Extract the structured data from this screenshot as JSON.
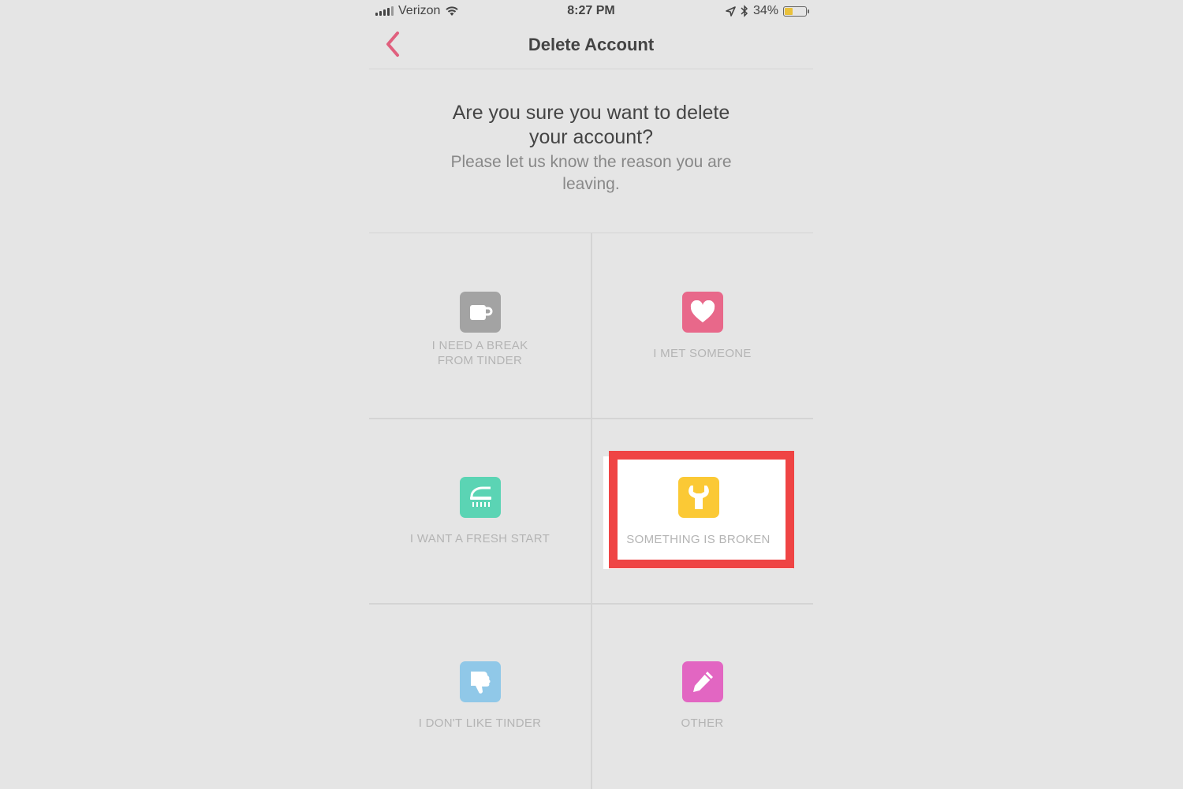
{
  "status_bar": {
    "carrier": "Verizon",
    "time": "8:27 PM",
    "battery_percent": "34%",
    "battery_level": 0.34
  },
  "nav": {
    "title": "Delete Account",
    "back_icon": "chevron-left-icon",
    "accent": "#e0607e"
  },
  "prompt": {
    "question": "Are you sure you want to delete your account?",
    "subtext": "Please let us know the reason you are leaving."
  },
  "reasons": [
    {
      "label_lines": [
        "I NEED A BREAK",
        "FROM TINDER"
      ],
      "icon": "coffee-cup-icon",
      "color": "#a3a3a3"
    },
    {
      "label_lines": [
        "I MET SOMEONE"
      ],
      "icon": "heart-icon",
      "color": "#e8688a"
    },
    {
      "label_lines": [
        "I WANT A FRESH START"
      ],
      "icon": "shower-icon",
      "color": "#5bd4b4"
    },
    {
      "label_lines": [
        "SOMETHING IS BROKEN"
      ],
      "icon": "wrench-icon",
      "color": "#fbc935",
      "selected": true
    },
    {
      "label_lines": [
        "I DON'T LIKE TINDER"
      ],
      "icon": "thumbs-down-icon",
      "color": "#90c8e8"
    },
    {
      "label_lines": [
        "OTHER"
      ],
      "icon": "pencil-icon",
      "color": "#e266c2"
    }
  ],
  "highlight_color": "#ef4444"
}
